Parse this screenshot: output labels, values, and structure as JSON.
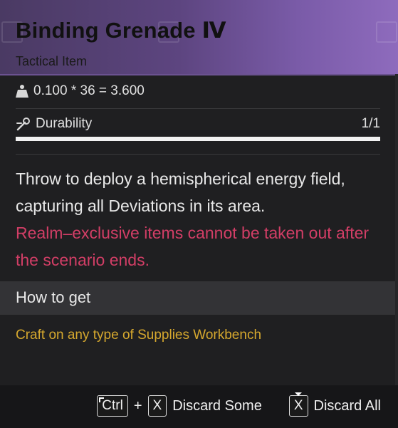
{
  "item": {
    "name": "Binding Grenade Ⅳ",
    "category": "Tactical Item",
    "weight_formula": "0.100 * 36 = 3.600",
    "durability_label": "Durability",
    "durability_value": "1/1",
    "durability_fraction": 1.0,
    "description": "Throw to deploy a hemispherical energy field, capturing all Deviations in its area.",
    "warning": "Realm–exclusive items cannot be taken out after the scenario ends."
  },
  "how_to_get": {
    "heading": "How to get",
    "source": "Craft on any type of Supplies Workbench"
  },
  "controls": {
    "ctrl_key": "Ctrl",
    "plus": "+",
    "x_key": "X",
    "discard_some": "Discard Some",
    "discard_all": "Discard All"
  },
  "colors": {
    "header_gradient_start": "#4a3a63",
    "header_gradient_end": "#8e6bbd",
    "warning_text": "#d23e66",
    "source_text": "#d6a82e"
  },
  "icons": {
    "weight": "weight-icon",
    "durability": "wrench-icon"
  }
}
